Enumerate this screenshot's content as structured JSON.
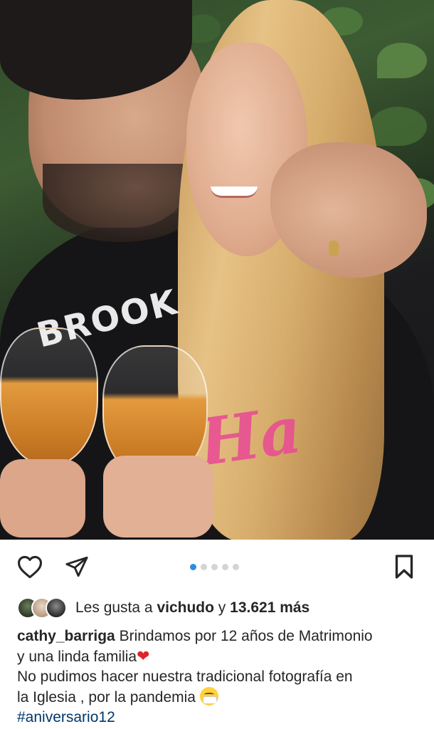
{
  "post": {
    "photo_text": [
      "BROOK",
      "Ha"
    ],
    "carousel": {
      "count": 5,
      "active_index": 0
    },
    "likes": {
      "prefix": "Les gusta a",
      "user": "vichudo",
      "connector": "y",
      "count": "13.621 más"
    },
    "caption": {
      "username": "cathy_barriga",
      "line1": "Brindamos por 12 años de Matrimonio",
      "line2": "y una linda familia",
      "line3": " No pudimos  hacer nuestra tradicional fotografía en",
      "line4": "la Iglesia , por la pandemia",
      "hashtag": "#aniversario12"
    },
    "icons": {
      "like": "heart-icon",
      "share": "paper-plane-icon",
      "save": "bookmark-icon"
    },
    "colors": {
      "carousel_active": "#2f8ae0",
      "hashtag": "#00376b",
      "text": "#262626"
    }
  }
}
